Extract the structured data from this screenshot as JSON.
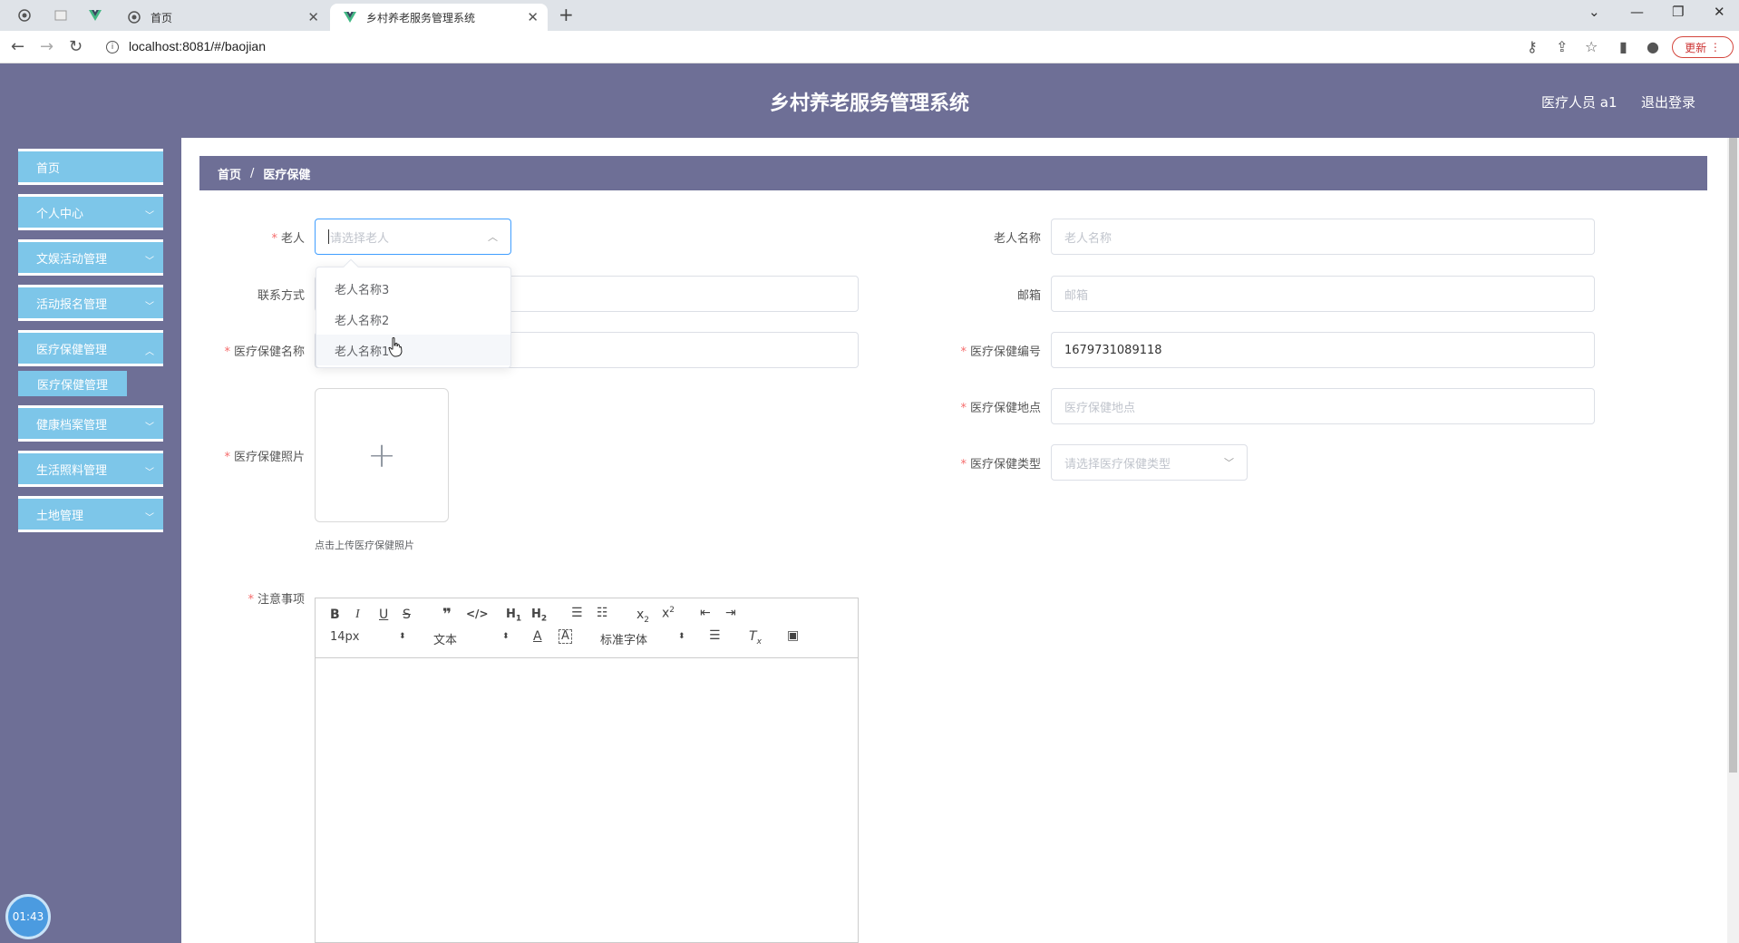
{
  "browser": {
    "tabs": [
      {
        "title": "首页"
      },
      {
        "title": "乡村养老服务管理系统"
      }
    ],
    "url": "localhost:8081/#/baojian",
    "update_label": "更新"
  },
  "header": {
    "title": "乡村养老服务管理系统",
    "user": "医疗人员 a1",
    "logout": "退出登录"
  },
  "sidebar": {
    "items": [
      {
        "label": "首页"
      },
      {
        "label": "个人中心"
      },
      {
        "label": "文娱活动管理"
      },
      {
        "label": "活动报名管理"
      },
      {
        "label": "医疗保健管理"
      },
      {
        "label": "健康档案管理"
      },
      {
        "label": "生活照料管理"
      },
      {
        "label": "土地管理"
      }
    ],
    "submenu_active": "医疗保健管理",
    "clock": "01:43"
  },
  "breadcrumb": {
    "home": "首页",
    "sep": "/",
    "current": "医疗保健"
  },
  "form": {
    "elder": {
      "label": "老人",
      "placeholder": "请选择老人"
    },
    "elder_name": {
      "label": "老人名称",
      "placeholder": "老人名称"
    },
    "contact": {
      "label": "联系方式"
    },
    "email": {
      "label": "邮箱",
      "placeholder": "邮箱"
    },
    "care_name": {
      "label": "医疗保健名称"
    },
    "care_no": {
      "label": "医疗保健编号",
      "value": "1679731089118"
    },
    "care_place": {
      "label": "医疗保健地点",
      "placeholder": "医疗保健地点"
    },
    "care_photo": {
      "label": "医疗保健照片",
      "tip": "点击上传医疗保健照片",
      "plus": "+"
    },
    "care_type": {
      "label": "医疗保健类型",
      "placeholder": "请选择医疗保健类型"
    },
    "notes": {
      "label": "注意事项"
    },
    "required_mark": "*"
  },
  "dropdown": {
    "options": [
      "老人名称3",
      "老人名称2",
      "老人名称1"
    ]
  },
  "editor": {
    "size": "14px",
    "header": "文本",
    "font": "标准字体"
  },
  "colors": {
    "header_bg": "#6e6f96",
    "menu_bg": "#7dc6e9",
    "required": "#f56c6c"
  }
}
